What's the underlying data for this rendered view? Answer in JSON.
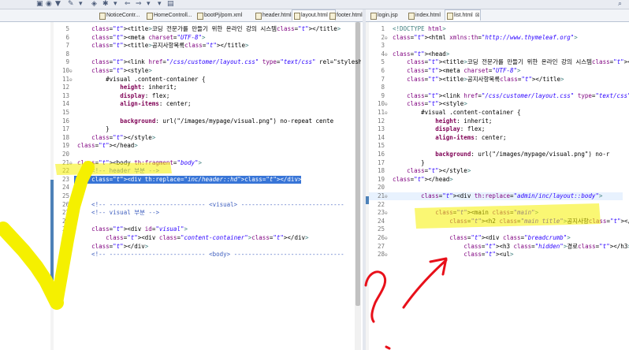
{
  "toolbar": {
    "icons": [
      "file-icon",
      "save-icon",
      "build-icon",
      "run-icon",
      "debug-icon",
      "nav-back-icon",
      "nav-forward-icon",
      "search-icon"
    ]
  },
  "left_tabs": [
    {
      "label": "NoticeContr...",
      "active": false
    },
    {
      "label": "HomeControll...",
      "active": false
    },
    {
      "label": "bootPj/pom.xml",
      "active": false
    },
    {
      "label": "header.html",
      "active": false
    },
    {
      "label": "layout.html",
      "active": true,
      "close": "⊠"
    },
    {
      "label": "footer.html",
      "active": false
    }
  ],
  "right_tabs": [
    {
      "label": "login.jsp",
      "active": false
    },
    {
      "label": "index.html",
      "active": false
    },
    {
      "label": "list.html",
      "active": true,
      "close": "⊠"
    }
  ],
  "left_editor": {
    "lines": [
      {
        "n": "5",
        "fold": "",
        "code": "    <title>코딩 전문가를 만들기 위한 온라인 강의 시스템</title>"
      },
      {
        "n": "6",
        "fold": "",
        "code": "    <meta charset=\"UTF-8\">"
      },
      {
        "n": "7",
        "fold": "",
        "code": "    <title>공지사항목록</title>"
      },
      {
        "n": "8",
        "fold": "",
        "code": ""
      },
      {
        "n": "9",
        "fold": "",
        "code": "    <link href=\"/css/customer/layout.css\" type=\"text/css\" rel=\"styleshee"
      },
      {
        "n": "10",
        "fold": "⊖",
        "code": "    <style>"
      },
      {
        "n": "11",
        "fold": "⊖",
        "code": "        #visual .content-container {"
      },
      {
        "n": "12",
        "fold": "",
        "code": "            height: inherit;"
      },
      {
        "n": "13",
        "fold": "",
        "code": "            display: flex;"
      },
      {
        "n": "14",
        "fold": "",
        "code": "            align-items: center;"
      },
      {
        "n": "15",
        "fold": "",
        "code": ""
      },
      {
        "n": "16",
        "fold": "",
        "code": "            background: url(\"/images/mypage/visual.png\") no-repeat cente"
      },
      {
        "n": "17",
        "fold": "",
        "code": "        }"
      },
      {
        "n": "18",
        "fold": "",
        "code": "    </style>"
      },
      {
        "n": "19",
        "fold": "",
        "code": "</head>"
      },
      {
        "n": "20",
        "fold": "",
        "code": ""
      },
      {
        "n": "21",
        "fold": "⊖",
        "code": "<body th:fragment=\"body\">"
      },
      {
        "n": "22",
        "fold": "",
        "code": "    <!-- header 부분 -->"
      },
      {
        "n": "23",
        "fold": "",
        "code": "    <div th:replace=\"inc/header::hd\"></div>"
      },
      {
        "n": "24",
        "fold": "",
        "code": ""
      },
      {
        "n": "25",
        "fold": "",
        "code": ""
      },
      {
        "n": "26",
        "fold": "",
        "code": "    <!-- --------------------------- <visual> -----------------------------"
      },
      {
        "n": "27",
        "fold": "",
        "code": "    <!-- visual 부분 -->"
      },
      {
        "n": "28",
        "fold": "",
        "code": ""
      },
      {
        "n": "29",
        "fold": "⊖",
        "code": "    <div id=\"visual\">"
      },
      {
        "n": "30",
        "fold": "",
        "code": "        <div class=\"content-container\"></div>"
      },
      {
        "n": "31",
        "fold": "",
        "code": "    </div>"
      },
      {
        "n": "32",
        "fold": "",
        "code": "    <!-- --------------------------- <body> -------------------------------"
      }
    ]
  },
  "right_editor": {
    "lines": [
      {
        "n": "1",
        "fold": "",
        "code": "<!DOCTYPE html>"
      },
      {
        "n": "2",
        "fold": "⊖",
        "code": "<html xmlns:th=\"http://www.thymeleaf.org\">"
      },
      {
        "n": "3",
        "fold": "",
        "code": ""
      },
      {
        "n": "4",
        "fold": "⊖",
        "code": "<head>"
      },
      {
        "n": "5",
        "fold": "",
        "code": "    <title>코딩 전문가를 만들기 위한 온라인 강의 시스템</title>"
      },
      {
        "n": "6",
        "fold": "",
        "code": "    <meta charset=\"UTF-8\">"
      },
      {
        "n": "7",
        "fold": "",
        "code": "    <title>공지사항목록</title>"
      },
      {
        "n": "8",
        "fold": "",
        "code": ""
      },
      {
        "n": "9",
        "fold": "",
        "code": "    <link href=\"/css/customer/layout.css\" type=\"text/css\" re"
      },
      {
        "n": "10",
        "fold": "⊖",
        "code": "    <style>"
      },
      {
        "n": "11",
        "fold": "⊖",
        "code": "        #visual .content-container {"
      },
      {
        "n": "12",
        "fold": "",
        "code": "            height: inherit;"
      },
      {
        "n": "13",
        "fold": "",
        "code": "            display: flex;"
      },
      {
        "n": "14",
        "fold": "",
        "code": "            align-items: center;"
      },
      {
        "n": "15",
        "fold": "",
        "code": ""
      },
      {
        "n": "16",
        "fold": "",
        "code": "            background: url(\"/images/mypage/visual.png\") no-r"
      },
      {
        "n": "17",
        "fold": "",
        "code": "        }"
      },
      {
        "n": "18",
        "fold": "",
        "code": "    </style>"
      },
      {
        "n": "19",
        "fold": "",
        "code": "</head>"
      },
      {
        "n": "20",
        "fold": "",
        "code": ""
      },
      {
        "n": "21",
        "fold": "⊖",
        "code": "        <div th:replace=\"admin/inc/layout::body\">"
      },
      {
        "n": "22",
        "fold": "",
        "code": ""
      },
      {
        "n": "23",
        "fold": "⊖",
        "code": "            <main class=\"main\">"
      },
      {
        "n": "24",
        "fold": "",
        "code": "                <h2 class=\"main title\">공지사항</h2>"
      },
      {
        "n": "25",
        "fold": "",
        "code": ""
      },
      {
        "n": "26",
        "fold": "⊖",
        "code": "                <div class=\"breadcrumb\">"
      },
      {
        "n": "27",
        "fold": "",
        "code": "                    <h3 class=\"hidden\">경로</h3>"
      },
      {
        "n": "28",
        "fold": "⊖",
        "code": "                    <ul>"
      }
    ]
  },
  "colors": {
    "highlighter": "#f5f000",
    "pen": "#e8101a",
    "selection": "#3875d7"
  }
}
